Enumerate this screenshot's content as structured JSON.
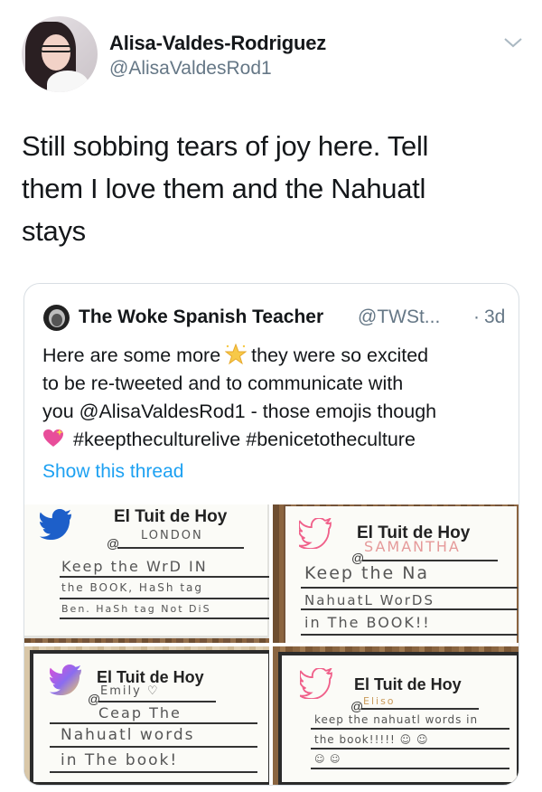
{
  "tweet": {
    "author_name": "Alisa-Valdes-Rodriguez",
    "author_handle": "@AlisaValdesRod1",
    "text_lines": [
      "Still sobbing tears of joy here. Tell",
      "them I love them and the Nahuatl",
      "stays"
    ]
  },
  "quoted_tweet": {
    "author_name": "The Woke Spanish Teacher",
    "author_handle": "@TWSt...",
    "separator": "·",
    "time": "3d",
    "line1_before": "Here are some more",
    "line1_after": "they were so excited",
    "line2": "to be re-tweeted and to communicate with",
    "line3": "you @AlisaValdesRod1 - those emojis though",
    "line4": "#keeptheculturelive #benicetotheculture",
    "show_thread": "Show this thread"
  },
  "photos": [
    {
      "title": "El Tuit de Hoy",
      "at_prefix": "@",
      "handle": "LONDON",
      "lines": [
        "Keep the   WrD IN",
        "the BOOK, HaSh tag",
        "Ben. HaSh tag Not DiS"
      ]
    },
    {
      "title": "El Tuit de Hoy",
      "at_prefix": "@",
      "handle": "SAMANTHA",
      "lines": [
        "Keep  the  Na",
        "NahuatL  WorDS",
        "in The BOOK!!"
      ]
    },
    {
      "title": "El Tuit de Hoy",
      "at_prefix": "@",
      "handle": "Emily ♡",
      "lines": [
        "Ceap   The",
        "Nahuatl  words",
        "in The book!"
      ]
    },
    {
      "title": "El Tuit de Hoy",
      "at_prefix": "@",
      "handle": "Eliso",
      "lines": [
        "keep the nahuatl words in",
        "the book!!!!! ☺ ☺",
        "☺ ☺"
      ]
    }
  ],
  "colors": {
    "link": "#1da1f2",
    "secondary_text": "#657786",
    "border": "#d8dee3",
    "twitter_bird_blue": "#1d5fc9",
    "twitter_bird_pink": "#f0608a",
    "twitter_bird_rainbow": [
      "#e04bd6",
      "#8a6cf0",
      "#f5d35a"
    ]
  },
  "icons": {
    "chevron": "chevron-down-icon",
    "star": "glowing-star-emoji",
    "heart": "sparkling-heart-emoji",
    "bird": "twitter-bird-icon"
  }
}
